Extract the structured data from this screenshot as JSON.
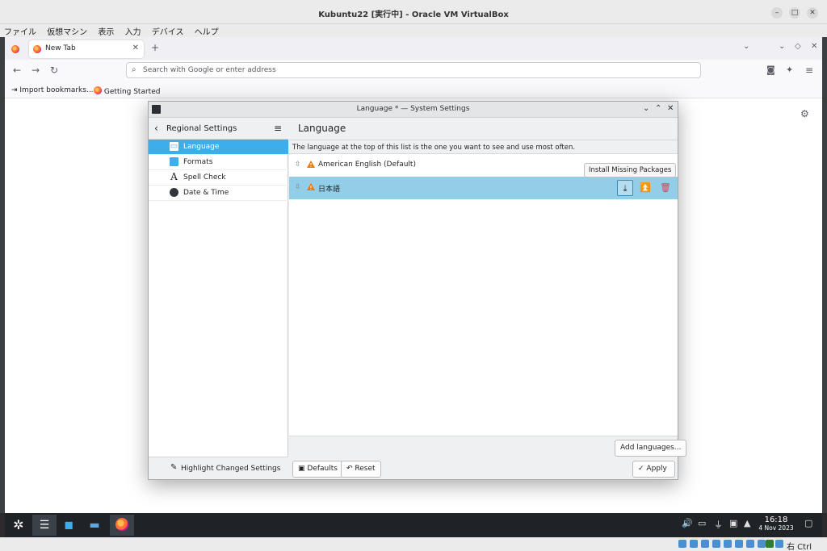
{
  "vbox": {
    "title": "Kubuntu22 [実行中] - Oracle VM VirtualBox",
    "menu": [
      "ファイル",
      "仮想マシン",
      "表示",
      "入力",
      "デバイス",
      "ヘルプ"
    ],
    "host_key": "右 Ctrl"
  },
  "firefox": {
    "tab_label": "New Tab",
    "url_placeholder": "Search with Google or enter address",
    "bookmarks": [
      "Import bookmarks...",
      "Getting Started"
    ]
  },
  "dialog": {
    "title": "Language * — System Settings",
    "sidebar_title": "Regional Settings",
    "sidebar_items": [
      {
        "label": "Language",
        "icon": "language-icon"
      },
      {
        "label": "Formats",
        "icon": "formats-icon"
      },
      {
        "label": "Spell Check",
        "icon": "spell-check-icon"
      },
      {
        "label": "Date & Time",
        "icon": "clock-icon"
      }
    ],
    "highlight_label": "Highlight Changed Settings",
    "page_title": "Language",
    "info_text": "The language at the top of this list is the one you want to see and use most often.",
    "languages": [
      "American English (Default)",
      "日本語"
    ],
    "tooltip": "Install Missing Packages",
    "add_languages": "Add languages...",
    "defaults": "Defaults",
    "reset": "Reset",
    "apply": "Apply"
  },
  "taskbar": {
    "time": "16:18",
    "date": "4 Nov 2023"
  },
  "colors": {
    "accent": "#3daee9",
    "selected_row": "#93cee9",
    "warning": "#f67400",
    "delete": "#da4453"
  }
}
